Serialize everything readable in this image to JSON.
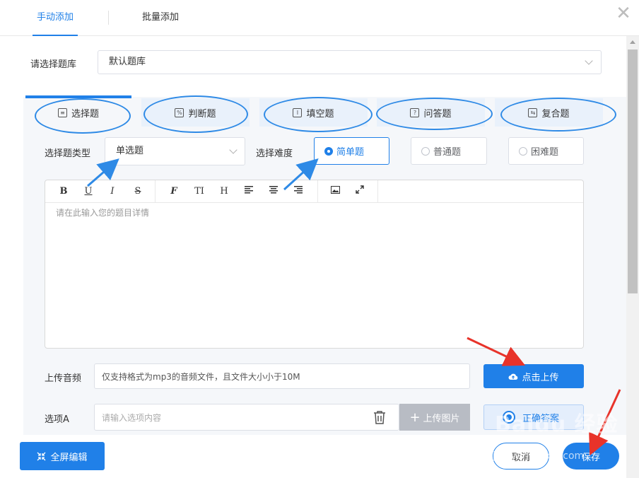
{
  "top_tabs": {
    "manual": "手动添加",
    "batch": "批量添加",
    "close": "✕"
  },
  "bank": {
    "label": "请选择题库",
    "value": "默认题库"
  },
  "type_tabs": [
    {
      "label": "选择题",
      "icon": "list-icon",
      "active": true
    },
    {
      "label": "判断题",
      "icon": "percent-icon"
    },
    {
      "label": "填空题",
      "icon": "text-cursor-icon"
    },
    {
      "label": "问答题",
      "icon": "question-icon"
    },
    {
      "label": "复合题",
      "icon": "composite-icon"
    }
  ],
  "question_type": {
    "label": "选择题类型",
    "value": "单选题"
  },
  "difficulty": {
    "label": "选择难度",
    "options": [
      {
        "label": "简单题",
        "selected": true
      },
      {
        "label": "普通题",
        "selected": false
      },
      {
        "label": "困难题",
        "selected": false
      }
    ]
  },
  "editor": {
    "toolbar": [
      "B",
      "U",
      "I",
      "S",
      "F",
      "TI",
      "H"
    ],
    "placeholder": "请在此输入您的题目详情"
  },
  "audio": {
    "label": "上传音频",
    "placeholder": "仅支持格式为mp3的音频文件，且文件大小小于10M",
    "upload_label": "点击上传"
  },
  "option_a": {
    "label": "选项A",
    "placeholder": "请输入选项内容",
    "upload_image_label": "上传图片",
    "correct_label": "正确答案"
  },
  "footer": {
    "fullscreen_label": "全屏编辑",
    "cancel_label": "取消",
    "save_label": "保存"
  },
  "watermark": {
    "main": "Baidu 经验",
    "sub": "jingyan.baidu.com"
  },
  "colors": {
    "accent": "#2080e8",
    "annotation": "#2e8ae6",
    "arrow": "#e8332a"
  }
}
